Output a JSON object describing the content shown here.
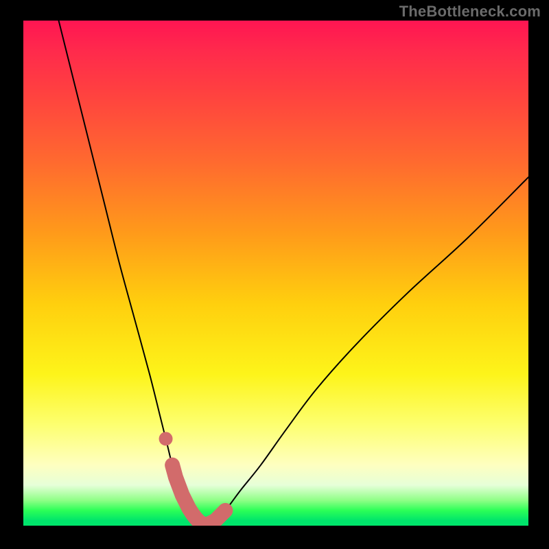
{
  "watermark": "TheBottleneck.com",
  "chart_data": {
    "type": "line",
    "title": "",
    "xlabel": "",
    "ylabel": "",
    "xlim": [
      0,
      100
    ],
    "ylim": [
      0,
      100
    ],
    "grid": false,
    "legend": false,
    "series": [
      {
        "name": "curve",
        "x": [
          7,
          10,
          13,
          16,
          19,
          22,
          25,
          27,
          28.5,
          30,
          31.5,
          33,
          34.5,
          36,
          38,
          40,
          43,
          47,
          52,
          58,
          66,
          76,
          88,
          100
        ],
        "values": [
          100,
          88,
          76,
          64,
          52,
          41,
          30,
          22,
          16,
          10,
          6,
          3,
          1,
          0,
          1,
          3,
          7,
          12,
          19,
          27,
          36,
          46,
          57,
          69
        ]
      }
    ],
    "annotations": {
      "valley_highlight": {
        "color": "#d26b6b",
        "segment_x": [
          29.5,
          40
        ],
        "dot_x": 28.2
      }
    },
    "background_gradient": {
      "stops": [
        {
          "pos": 0.0,
          "color": "#ff1552"
        },
        {
          "pos": 0.28,
          "color": "#ff6a2f"
        },
        {
          "pos": 0.56,
          "color": "#ffcf0e"
        },
        {
          "pos": 0.8,
          "color": "#fdff70"
        },
        {
          "pos": 0.92,
          "color": "#e6ffd8"
        },
        {
          "pos": 0.97,
          "color": "#2bff57"
        },
        {
          "pos": 1.0,
          "color": "#00e46b"
        }
      ]
    }
  }
}
